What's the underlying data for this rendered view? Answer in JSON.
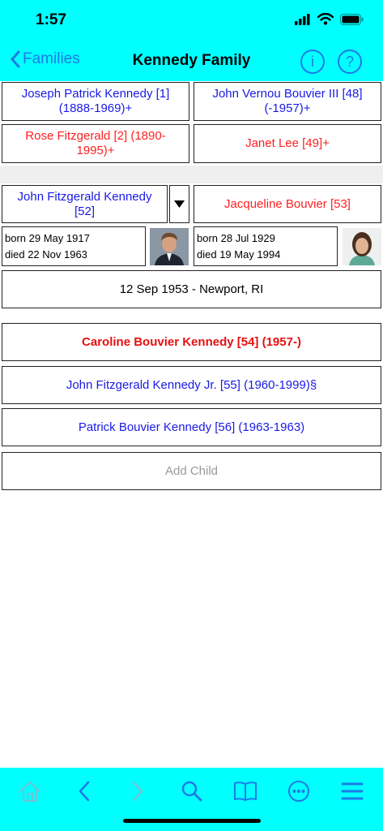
{
  "status": {
    "time": "1:57"
  },
  "nav": {
    "back_label": "Families",
    "title": "Kennedy Family",
    "info_label": "i",
    "help_label": "?"
  },
  "grandparents": {
    "father_father": "Joseph Patrick Kennedy [1] (1888-1969)+",
    "mother_father": "John Vernou Bouvier III [48] (-1957)+",
    "father_mother": "Rose Fitzgerald [2] (1890-1995)+",
    "mother_mother": "Janet Lee [49]+"
  },
  "husband": {
    "name": "John Fitzgerald Kennedy [52]",
    "born": "born 29 May 1917",
    "died": "died 22 Nov 1963"
  },
  "wife": {
    "name": "Jacqueline Bouvier [53]",
    "born": "born 28 Jul 1929",
    "died": "died 19 May 1994"
  },
  "marriage": "12 Sep 1953 - Newport, RI",
  "children": [
    "Caroline Bouvier Kennedy [54] (1957-)",
    "John Fitzgerald Kennedy Jr. [55] (1960-1999)§",
    "Patrick Bouvier Kennedy [56] (1963-1963)"
  ],
  "add_child_label": "Add Child",
  "tabs": [
    "home-icon",
    "back-arrow-icon",
    "forward-arrow-icon",
    "search-icon",
    "book-icon",
    "more-icon",
    "menu-icon"
  ],
  "colors": {
    "bar": "#00ffff",
    "accent": "#1e7be6",
    "male": "#1a1ae6",
    "female": "#ff2020"
  }
}
